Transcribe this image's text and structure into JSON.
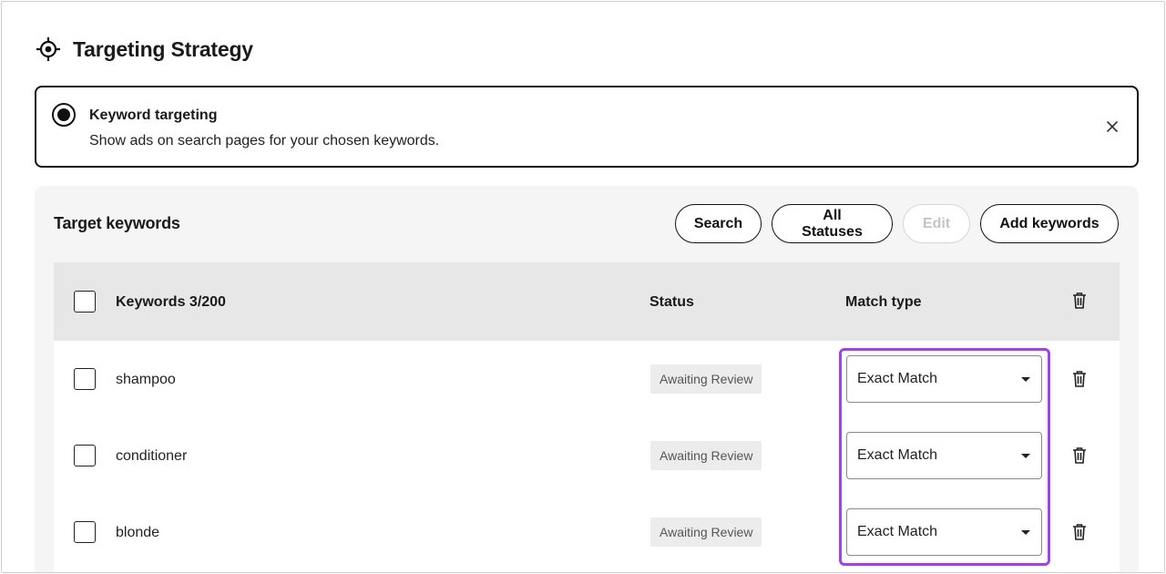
{
  "header": {
    "title": "Targeting Strategy",
    "icon": "crosshair-target-icon"
  },
  "strategy": {
    "title": "Keyword targeting",
    "description": "Show ads on search pages for your chosen keywords.",
    "close_icon": "close-icon"
  },
  "panel": {
    "title": "Target keywords",
    "actions": {
      "search": "Search",
      "all_statuses": "All Statuses",
      "edit": "Edit",
      "add": "Add keywords"
    }
  },
  "table": {
    "headers": {
      "keywords": "Keywords 3/200",
      "status": "Status",
      "match_type": "Match type"
    },
    "rows": [
      {
        "keyword": "shampoo",
        "status": "Awaiting Review",
        "match_type": "Exact Match"
      },
      {
        "keyword": "conditioner",
        "status": "Awaiting Review",
        "match_type": "Exact Match"
      },
      {
        "keyword": "blonde",
        "status": "Awaiting Review",
        "match_type": "Exact Match"
      }
    ]
  },
  "colors": {
    "highlight": "#9b45e4",
    "header_bg": "#e7e7e7",
    "panel_bg": "#f5f5f5",
    "disabled": "#c4c4c4"
  }
}
